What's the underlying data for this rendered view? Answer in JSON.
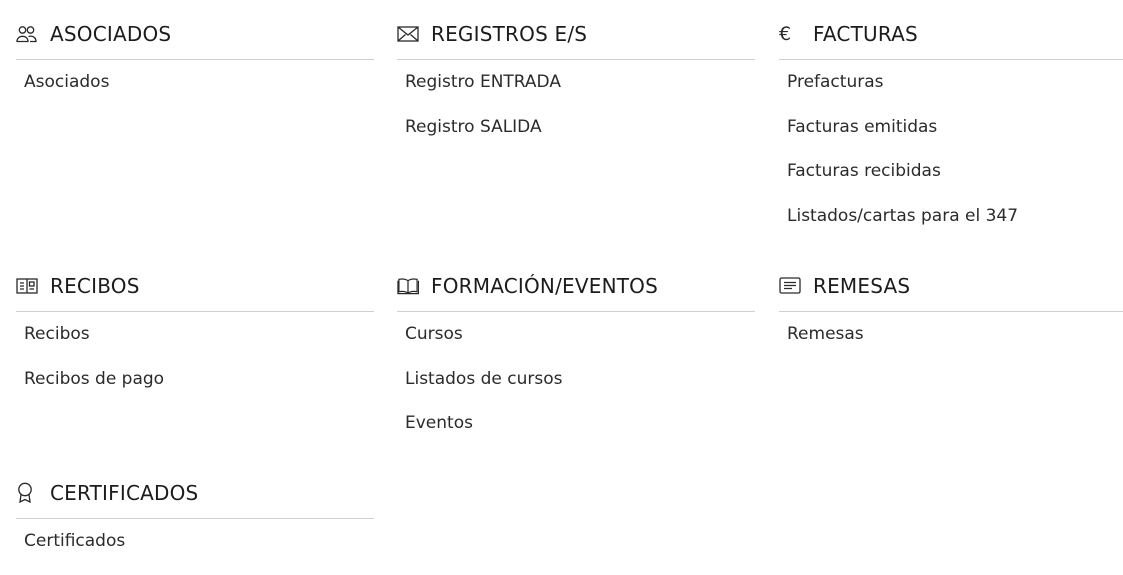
{
  "sections": {
    "asociados": {
      "icon": "users-icon",
      "title": "ASOCIADOS",
      "items": [
        "Asociados"
      ]
    },
    "registros": {
      "icon": "envelope-icon",
      "title": "REGISTROS E/S",
      "items": [
        "Registro ENTRADA",
        "Registro SALIDA"
      ]
    },
    "facturas": {
      "icon": "euro-icon",
      "icon_glyph": "€",
      "title": "FACTURAS",
      "items": [
        "Prefacturas",
        "Facturas emitidas",
        "Facturas recibidas",
        "Listados/cartas para el 347"
      ]
    },
    "recibos": {
      "icon": "receipt-icon",
      "title": "RECIBOS",
      "items": [
        "Recibos",
        "Recibos de pago"
      ]
    },
    "formacion": {
      "icon": "open-book-icon",
      "title": "FORMACIÓN/EVENTOS",
      "items": [
        "Cursos",
        "Listados de cursos",
        "Eventos"
      ]
    },
    "remesas": {
      "icon": "document-list-icon",
      "title": "REMESAS",
      "items": [
        "Remesas"
      ]
    },
    "certificados": {
      "icon": "award-ribbon-icon",
      "title": "CERTIFICADOS",
      "items": [
        "Certificados"
      ]
    }
  }
}
